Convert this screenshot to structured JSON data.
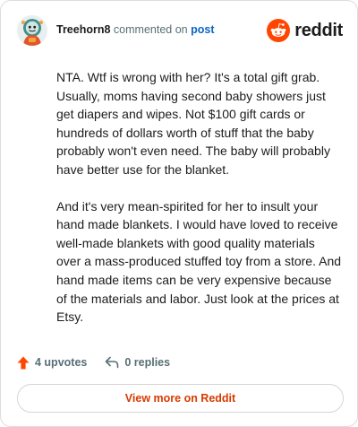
{
  "header": {
    "username": "Treehorn8",
    "commented_text": "commented on",
    "post_link": "post",
    "brand_name": "reddit"
  },
  "comment": {
    "paragraphs": [
      "NTA. Wtf is wrong with her? It's a total gift grab. Usually, moms having second baby showers just get diapers and wipes. Not $100 gift cards or hundreds of dollars worth of stuff that the baby probably won't even need. The baby will probably have better use for the blanket.",
      "And it's very mean-spirited for her to insult your hand made blankets. I would have loved to receive well-made blankets with good quality materials over a mass-produced stuffed toy from a store. And hand made items can be very expensive because of the materials and labor. Just look at the prices at Etsy."
    ]
  },
  "actions": {
    "upvotes": "4 upvotes",
    "replies": "0 replies"
  },
  "footer": {
    "view_more_label": "View more on Reddit"
  },
  "colors": {
    "brand_orange": "#ff4500",
    "upvote_orange": "#ff4500",
    "link_blue": "#0a66c2",
    "view_more_text": "#d93a00"
  },
  "icons": {
    "avatar": "user-avatar-icon",
    "brand": "reddit-logo-icon",
    "upvote": "upvote-arrow-icon",
    "reply": "reply-arrow-icon"
  }
}
